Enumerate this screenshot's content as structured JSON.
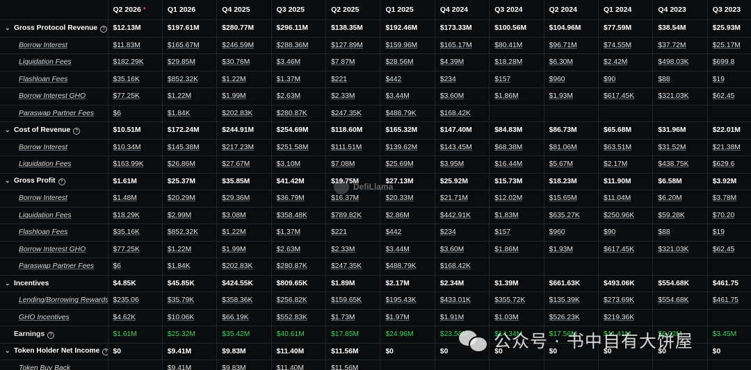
{
  "columns": [
    "Q2 2026",
    "Q1 2026",
    "Q4 2025",
    "Q3 2025",
    "Q2 2025",
    "Q1 2025",
    "Q4 2024",
    "Q3 2024",
    "Q2 2024",
    "Q1 2024",
    "Q4 2023",
    "Q3 2023"
  ],
  "header_star": "*",
  "rows": [
    {
      "label": "Gross Protocol Revenue",
      "type": "parent",
      "info": true,
      "values": [
        "$12.13M",
        "$197.61M",
        "$280.77M",
        "$296.11M",
        "$138.35M",
        "$192.46M",
        "$173.33M",
        "$100.56M",
        "$104.96M",
        "$77.59M",
        "$38.54M",
        "$25.93M"
      ]
    },
    {
      "label": "Borrow Interest",
      "type": "child",
      "values": [
        "$11.83M",
        "$165.67M",
        "$246.59M",
        "$288.36M",
        "$127.89M",
        "$159.96M",
        "$165.17M",
        "$80.41M",
        "$96.71M",
        "$74.55M",
        "$37.72M",
        "$25.17M"
      ]
    },
    {
      "label": "Liquidation Fees",
      "type": "child",
      "values": [
        "$182.29K",
        "$29.85M",
        "$30.76M",
        "$3.46M",
        "$7.87M",
        "$28.56M",
        "$4.39M",
        "$18.28M",
        "$6.30M",
        "$2.42M",
        "$498.03K",
        "$699.8"
      ]
    },
    {
      "label": "Flashloan Fees",
      "type": "child",
      "values": [
        "$35.16K",
        "$852.32K",
        "$1.22M",
        "$1.37M",
        "$221",
        "$442",
        "$234",
        "$157",
        "$960",
        "$90",
        "$88",
        "$19"
      ]
    },
    {
      "label": "Borrow Interest GHO",
      "type": "child",
      "values": [
        "$77.25K",
        "$1.22M",
        "$1.99M",
        "$2.63M",
        "$2.33M",
        "$3.44M",
        "$3.60M",
        "$1.86M",
        "$1.93M",
        "$617.45K",
        "$321.03K",
        "$62.45"
      ]
    },
    {
      "label": "Paraswap Partner Fees",
      "type": "child",
      "values": [
        "$6",
        "$1.84K",
        "$202.83K",
        "$280.87K",
        "$247.35K",
        "$488.79K",
        "$168.42K",
        "",
        "",
        "",
        "",
        ""
      ]
    },
    {
      "label": "Cost of Revenue",
      "type": "parent",
      "info": true,
      "values": [
        "$10.51M",
        "$172.24M",
        "$244.91M",
        "$254.69M",
        "$118.60M",
        "$165.32M",
        "$147.40M",
        "$84.83M",
        "$86.73M",
        "$65.68M",
        "$31.96M",
        "$22.01M"
      ]
    },
    {
      "label": "Borrow Interest",
      "type": "child",
      "values": [
        "$10.34M",
        "$145.38M",
        "$217.23M",
        "$251.58M",
        "$111.51M",
        "$139.62M",
        "$143.45M",
        "$68.38M",
        "$81.06M",
        "$63.51M",
        "$31.52M",
        "$21.38M"
      ]
    },
    {
      "label": "Liquidation Fees",
      "type": "child",
      "values": [
        "$163.99K",
        "$26.86M",
        "$27.67M",
        "$3.10M",
        "$7.08M",
        "$25.69M",
        "$3.95M",
        "$16.44M",
        "$5.67M",
        "$2.17M",
        "$438.75K",
        "$629.6"
      ]
    },
    {
      "label": "Gross Profit",
      "type": "parent",
      "info": true,
      "values": [
        "$1.61M",
        "$25.37M",
        "$35.85M",
        "$41.42M",
        "$19.75M",
        "$27.13M",
        "$25.92M",
        "$15.73M",
        "$18.23M",
        "$11.90M",
        "$6.58M",
        "$3.92M"
      ]
    },
    {
      "label": "Borrow Interest",
      "type": "child",
      "values": [
        "$1.48M",
        "$20.29M",
        "$29.36M",
        "$36.79M",
        "$16.37M",
        "$20.33M",
        "$21.71M",
        "$12.02M",
        "$15.65M",
        "$11.04M",
        "$6.20M",
        "$3.78M"
      ]
    },
    {
      "label": "Liquidation Fees",
      "type": "child",
      "values": [
        "$18.29K",
        "$2.99M",
        "$3.08M",
        "$358.48K",
        "$789.82K",
        "$2.86M",
        "$442.91K",
        "$1.83M",
        "$635.27K",
        "$250.96K",
        "$59.28K",
        "$70.20"
      ]
    },
    {
      "label": "Flashloan Fees",
      "type": "child",
      "values": [
        "$35.16K",
        "$852.32K",
        "$1.22M",
        "$1.37M",
        "$221",
        "$442",
        "$234",
        "$157",
        "$960",
        "$90",
        "$88",
        "$19"
      ]
    },
    {
      "label": "Borrow Interest GHO",
      "type": "child",
      "values": [
        "$77.25K",
        "$1.22M",
        "$1.99M",
        "$2.63M",
        "$2.33M",
        "$3.44M",
        "$3.60M",
        "$1.86M",
        "$1.93M",
        "$617.45K",
        "$321.03K",
        "$62.45"
      ]
    },
    {
      "label": "Paraswap Partner Fees",
      "type": "child",
      "values": [
        "$6",
        "$1.84K",
        "$202.83K",
        "$280.87K",
        "$247.35K",
        "$488.79K",
        "$168.42K",
        "",
        "",
        "",
        "",
        ""
      ]
    },
    {
      "label": "Incentives",
      "type": "parent",
      "info": false,
      "values": [
        "$4.85K",
        "$45.85K",
        "$424.55K",
        "$809.65K",
        "$1.89M",
        "$2.17M",
        "$2.34M",
        "$1.39M",
        "$661.63K",
        "$493.06K",
        "$554.68K",
        "$461.75"
      ]
    },
    {
      "label": "Lending/Borrowing Rewards",
      "type": "child",
      "values": [
        "$235.06",
        "$35.79K",
        "$358.36K",
        "$256.82K",
        "$159.65K",
        "$195.43K",
        "$433.01K",
        "$355.72K",
        "$135.39K",
        "$273.69K",
        "$554.68K",
        "$461.75"
      ]
    },
    {
      "label": "GHO Incentives",
      "type": "child",
      "values": [
        "$4.62K",
        "$10.06K",
        "$66.19K",
        "$552.83K",
        "$1.73M",
        "$1.97M",
        "$1.91M",
        "$1.03M",
        "$526.23K",
        "$219.36K",
        "",
        ""
      ]
    },
    {
      "label": "Earnings",
      "type": "green",
      "info": true,
      "values": [
        "$1.61M",
        "$25.32M",
        "$35.42M",
        "$40.61M",
        "$17.85M",
        "$24.96M",
        "$23.58M",
        "$14.34M",
        "$17.56M",
        "$11.41M",
        "$6.02M",
        "$3.45M"
      ]
    },
    {
      "label": "Token Holder Net Income",
      "type": "parent",
      "info": true,
      "values": [
        "$0",
        "$9.41M",
        "$9.83M",
        "$11.40M",
        "$11.56M",
        "$0",
        "$0",
        "$0",
        "$0",
        "$0",
        "$0",
        "$0"
      ]
    },
    {
      "label": "Token Buy Back",
      "type": "child",
      "values": [
        "",
        "$9.41M",
        "$9.83M",
        "$11.40M",
        "$11.56M",
        "",
        "",
        "",
        "",
        "",
        "",
        ""
      ]
    }
  ],
  "watermarks": {
    "center": "DefiLlama",
    "wechat": "公众号 · 书中自有大饼屋"
  },
  "colors": {
    "background": "#0b0c0e",
    "earnings_green": "#3ed65c",
    "star_red": "#e8414a"
  }
}
